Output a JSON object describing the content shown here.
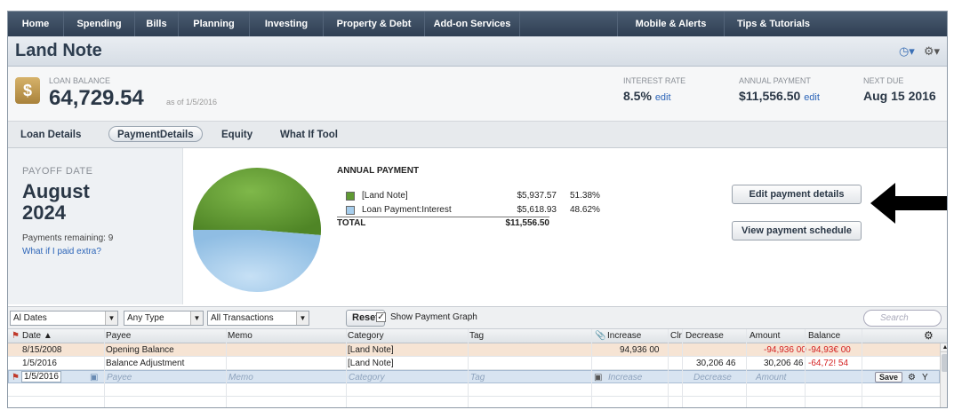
{
  "nav": {
    "items": [
      "Home",
      "Spending",
      "Bills",
      "Planning",
      "Investing",
      "Property & Debt",
      "Add-on Services",
      "Mobile & Alerts",
      "Tips & Tutorials"
    ]
  },
  "title": "Land Note",
  "summary": {
    "loan_balance_label": "LOAN BALANCE",
    "loan_balance": "64,729.54",
    "as_of": "as of 1/5/2016",
    "interest_rate_label": "INTEREST RATE",
    "interest_rate": "8.5%",
    "annual_payment_label": "ANNUAL PAYMENT",
    "annual_payment": "$11,556.50",
    "next_due_label": "NEXT DUE",
    "next_due": "Aug 15 2016",
    "edit_label": "edit"
  },
  "tabs": [
    "Loan Details",
    "PaymentDetails",
    "Equity",
    "What If Tool"
  ],
  "payoff": {
    "label": "PAYOFF DATE",
    "month": "August",
    "year": "2024",
    "remaining": "Payments remaining: 9",
    "what_if_link": "What if I paid extra?"
  },
  "annual": {
    "title": "ANNUAL PAYMENT",
    "rows": [
      {
        "name": "[Land Note]",
        "amount": "$5,937.57",
        "pct": "51.38%"
      },
      {
        "name": "Loan Payment:Interest",
        "amount": "$5,618.93",
        "pct": "48.62%"
      }
    ],
    "total_label": "TOTAL",
    "total_amount": "$11,556.50"
  },
  "chart_data": {
    "type": "pie",
    "labels": [
      "[Land Note]",
      "Loan Payment:Interest"
    ],
    "values": [
      51.38,
      48.62
    ],
    "colors": [
      "#5f9a32",
      "#a6cdec"
    ]
  },
  "buttons": {
    "edit_payment_details": "Edit payment details",
    "view_payment_schedule": "View payment schedule"
  },
  "filters": {
    "dates": "Al Dates",
    "type": "Any Type",
    "transactions": "All Transactions",
    "reset": "Reset",
    "show_graph": "Show Payment Graph",
    "search_placeholder": "Search"
  },
  "register": {
    "headers": {
      "date": "Date ▲",
      "payee": "Payee",
      "memo": "Memo",
      "category": "Category",
      "tag": "Tag",
      "increase": "Increase",
      "clr": "Clr",
      "decrease": "Decrease",
      "amount": "Amount",
      "balance": "Balance"
    },
    "rows": [
      {
        "date": "8/15/2008",
        "payee": "Opening Balance",
        "memo": "",
        "category": "[Land Note]",
        "tag": "",
        "increase": "94,936 00",
        "decrease": "",
        "amount": "-94,936 00",
        "balance": "-94,93€ 00"
      },
      {
        "date": "1/5/2016",
        "payee": "Balance Adjustment",
        "memo": "",
        "category": "[Land Note]",
        "tag": "",
        "increase": "",
        "decrease": "30,206 46",
        "amount": "30,206 46",
        "balance": "-64,72! 54"
      }
    ],
    "edit_row": {
      "date": "1/5/2016",
      "payee": "Payee",
      "memo": "Memo",
      "category": "Category",
      "tag": "Tag",
      "increase": "Increase",
      "decrease": "Decrease",
      "amount": "Amount",
      "save": "Save"
    }
  }
}
